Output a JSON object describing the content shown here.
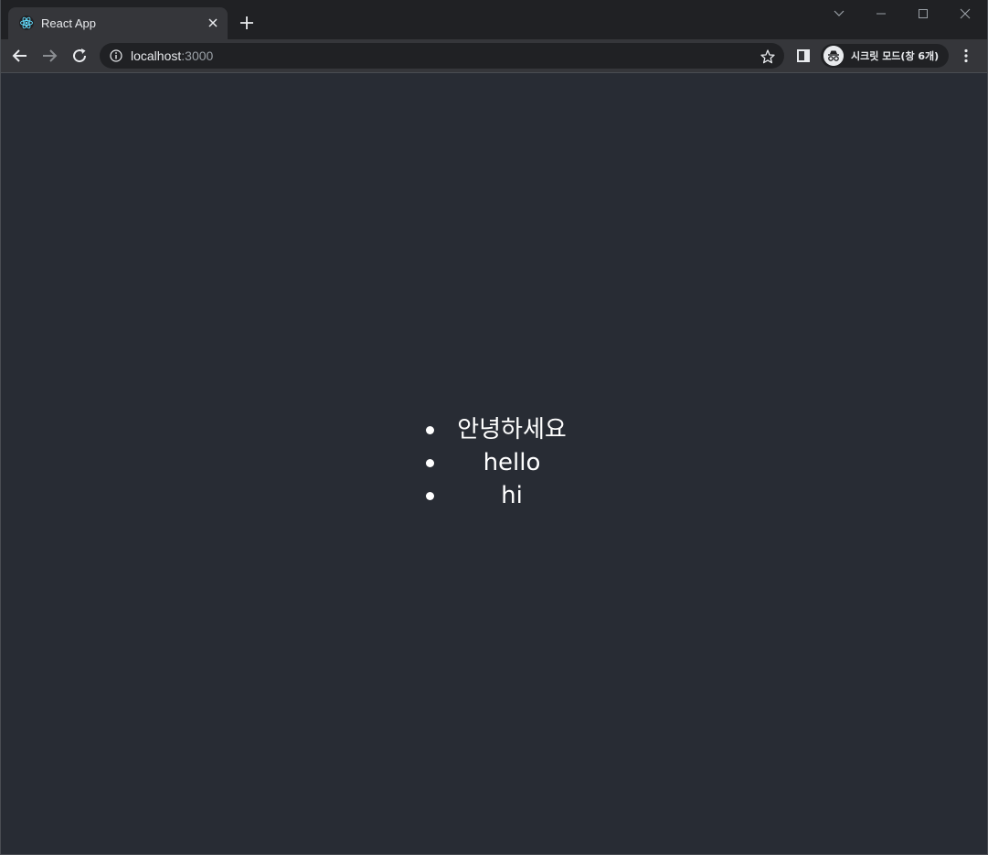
{
  "browser": {
    "tab": {
      "title": "React App",
      "favicon": "react-logo-icon"
    },
    "toolbar": {
      "url_host": "localhost",
      "url_port": ":3000",
      "profile_label": "시크릿 모드(창 6개)"
    },
    "colors": {
      "frame": "#202124",
      "toolbar": "#35363a",
      "page_background": "#282c34",
      "text": "#ffffff"
    }
  },
  "page": {
    "items": [
      {
        "text": "안녕하세요"
      },
      {
        "text": "hello"
      },
      {
        "text": "hi"
      }
    ]
  }
}
